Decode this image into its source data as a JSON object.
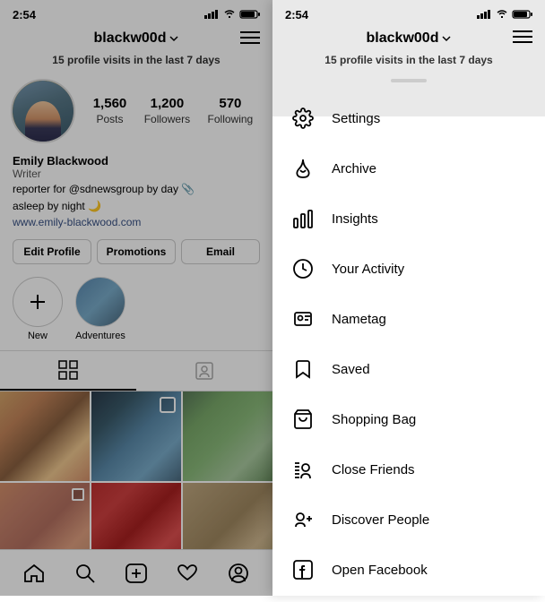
{
  "left": {
    "status": {
      "time": "2:54",
      "signal_icon": "signal",
      "wifi_icon": "wifi",
      "battery_icon": "battery"
    },
    "header": {
      "username": "blackw00d",
      "menu_icon": "≡"
    },
    "profile_visits": {
      "count": "15",
      "text": "profile visits in the last 7 days"
    },
    "stats": {
      "posts_count": "1,560",
      "posts_label": "Posts",
      "followers_count": "1,200",
      "followers_label": "Followers",
      "following_count": "570",
      "following_label": "Following"
    },
    "bio": {
      "name": "Emily Blackwood",
      "title": "Writer",
      "line1": "reporter for @sdnewsgroup by day 📎",
      "line2": "asleep by night 🌙",
      "link": "www.emily-blackwood.com"
    },
    "buttons": {
      "edit": "Edit Profile",
      "promotions": "Promotions",
      "email": "Email"
    },
    "highlights": [
      {
        "label": "New",
        "type": "new"
      },
      {
        "label": "Adventures",
        "type": "image"
      }
    ],
    "nav": {
      "home": "home",
      "search": "search",
      "add": "add",
      "heart": "heart",
      "profile": "profile"
    }
  },
  "right": {
    "status": {
      "time": "2:54"
    },
    "header": {
      "username": "blackw00d"
    },
    "profile_visits": {
      "count": "15",
      "text": "profile visits in the last 7 days"
    },
    "menu_items": [
      {
        "id": "settings",
        "label": "Settings",
        "icon": "settings"
      },
      {
        "id": "archive",
        "label": "Archive",
        "icon": "archive"
      },
      {
        "id": "insights",
        "label": "Insights",
        "icon": "insights"
      },
      {
        "id": "your-activity",
        "label": "Your Activity",
        "icon": "activity"
      },
      {
        "id": "nametag",
        "label": "Nametag",
        "icon": "nametag"
      },
      {
        "id": "saved",
        "label": "Saved",
        "icon": "saved"
      },
      {
        "id": "shopping-bag",
        "label": "Shopping Bag",
        "icon": "bag"
      },
      {
        "id": "close-friends",
        "label": "Close Friends",
        "icon": "friends"
      },
      {
        "id": "discover-people",
        "label": "Discover People",
        "icon": "discover"
      },
      {
        "id": "open-facebook",
        "label": "Open Facebook",
        "icon": "facebook"
      }
    ]
  }
}
